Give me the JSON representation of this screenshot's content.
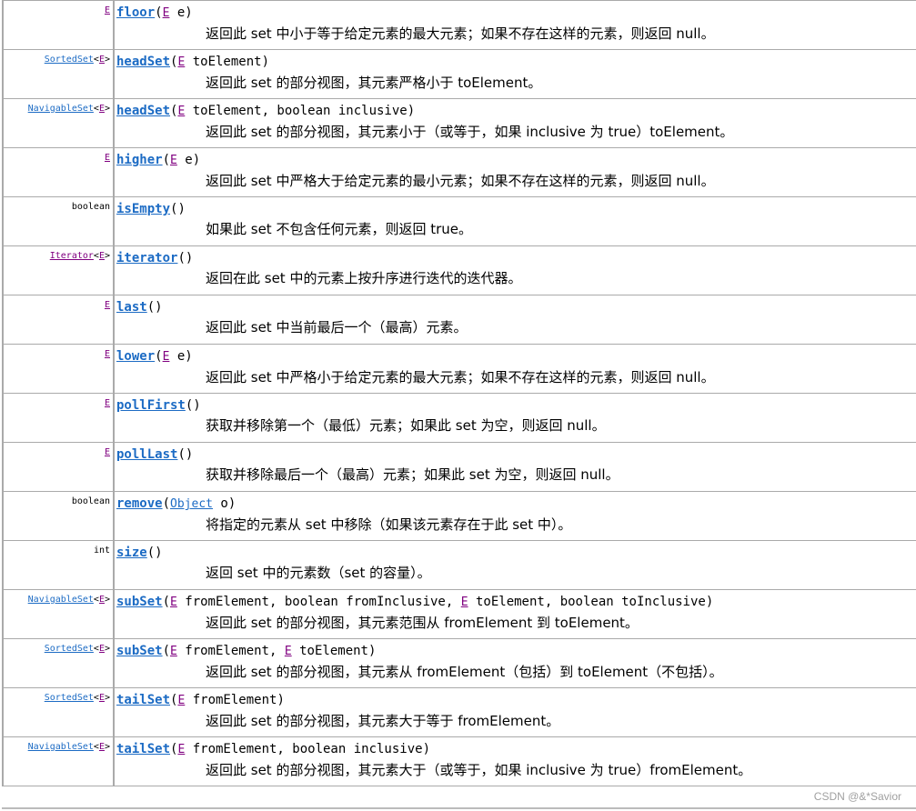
{
  "rows": [
    {
      "type": {
        "link": "E",
        "link_color": "purple"
      },
      "method": "floor",
      "params": [
        {
          "type": "E",
          "type_link": true,
          "text": " e"
        }
      ],
      "desc": "返回此 set 中小于等于给定元素的最大元素；如果不存在这样的元素，则返回 null。"
    },
    {
      "type": {
        "link": "SortedSet",
        "link_color": "blue",
        "generic": "E"
      },
      "method": "headSet",
      "params": [
        {
          "type": "E",
          "type_link": true,
          "text": " toElement"
        }
      ],
      "desc": "返回此 set 的部分视图，其元素严格小于 toElement。"
    },
    {
      "type": {
        "link": "NavigableSet",
        "link_color": "blue",
        "generic": "E"
      },
      "method": "headSet",
      "params": [
        {
          "type": "E",
          "type_link": true,
          "text": " toElement, boolean inclusive"
        }
      ],
      "desc": "返回此 set 的部分视图，其元素小于（或等于，如果 inclusive 为 true）toElement。"
    },
    {
      "type": {
        "link": "E",
        "link_color": "purple"
      },
      "method": "higher",
      "params": [
        {
          "type": "E",
          "type_link": true,
          "text": " e"
        }
      ],
      "desc": "返回此 set 中严格大于给定元素的最小元素；如果不存在这样的元素，则返回 null。"
    },
    {
      "type": {
        "plain": "boolean"
      },
      "method": "isEmpty",
      "params": [],
      "desc": "如果此 set 不包含任何元素，则返回 true。"
    },
    {
      "type": {
        "link": "Iterator",
        "link_color": "purple",
        "generic": "E"
      },
      "method": "iterator",
      "params": [],
      "desc": "返回在此 set 中的元素上按升序进行迭代的迭代器。"
    },
    {
      "type": {
        "link": "E",
        "link_color": "purple"
      },
      "method": "last",
      "params": [],
      "desc": "返回此 set 中当前最后一个（最高）元素。"
    },
    {
      "type": {
        "link": "E",
        "link_color": "purple"
      },
      "method": "lower",
      "params": [
        {
          "type": "E",
          "type_link": true,
          "text": " e"
        }
      ],
      "desc": "返回此 set 中严格小于给定元素的最大元素；如果不存在这样的元素，则返回 null。"
    },
    {
      "type": {
        "link": "E",
        "link_color": "purple"
      },
      "method": "pollFirst",
      "params": [],
      "desc": "获取并移除第一个（最低）元素；如果此 set 为空，则返回 null。"
    },
    {
      "type": {
        "link": "E",
        "link_color": "purple"
      },
      "method": "pollLast",
      "params": [],
      "desc": "获取并移除最后一个（最高）元素；如果此 set 为空，则返回 null。"
    },
    {
      "type": {
        "plain": "boolean"
      },
      "method": "remove",
      "params": [
        {
          "type": "Object",
          "type_link": true,
          "type_color": "blue",
          "text": " o"
        }
      ],
      "desc": "将指定的元素从 set 中移除（如果该元素存在于此 set 中）。"
    },
    {
      "type": {
        "plain": "int"
      },
      "method": "size",
      "params": [],
      "desc": "返回 set 中的元素数（set 的容量）。"
    },
    {
      "type": {
        "link": "NavigableSet",
        "link_color": "blue",
        "generic": "E"
      },
      "method": "subSet",
      "params": [
        {
          "type": "E",
          "type_link": true,
          "text": " fromElement, boolean fromInclusive, "
        },
        {
          "type": "E",
          "type_link": true,
          "text": " toElement, boolean toInclusive"
        }
      ],
      "desc": "返回此 set 的部分视图，其元素范围从 fromElement 到 toElement。"
    },
    {
      "type": {
        "link": "SortedSet",
        "link_color": "blue",
        "generic": "E"
      },
      "method": "subSet",
      "params": [
        {
          "type": "E",
          "type_link": true,
          "text": " fromElement, "
        },
        {
          "type": "E",
          "type_link": true,
          "text": " toElement"
        }
      ],
      "desc": "返回此 set 的部分视图，其元素从 fromElement（包括）到 toElement（不包括）。"
    },
    {
      "type": {
        "link": "SortedSet",
        "link_color": "blue",
        "generic": "E"
      },
      "method": "tailSet",
      "params": [
        {
          "type": "E",
          "type_link": true,
          "text": " fromElement"
        }
      ],
      "desc": "返回此 set 的部分视图，其元素大于等于 fromElement。"
    },
    {
      "type": {
        "link": "NavigableSet",
        "link_color": "blue",
        "generic": "E"
      },
      "method": "tailSet",
      "params": [
        {
          "type": "E",
          "type_link": true,
          "text": " fromElement, boolean inclusive"
        }
      ],
      "desc": "返回此 set 的部分视图，其元素大于（或等于，如果 inclusive 为 true）fromElement。"
    }
  ],
  "watermark": "CSDN @&*Savior",
  "colors": {
    "link_blue": "#1c6bc4",
    "link_visited": "#800080",
    "border": "#aaaaaa"
  }
}
